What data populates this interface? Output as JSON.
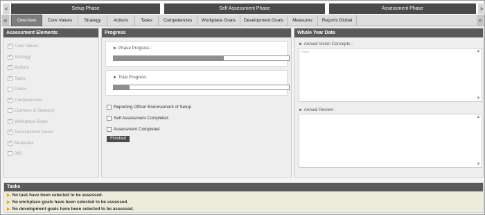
{
  "phases": [
    {
      "label": "Setup Phase"
    },
    {
      "label": "Self Assessment Phase"
    },
    {
      "label": "Assessment Phase"
    }
  ],
  "scroll": {
    "left": "«",
    "right": "»"
  },
  "tabs": [
    {
      "label": "Overview",
      "active": true
    },
    {
      "label": "Core Values"
    },
    {
      "label": "Strategy"
    },
    {
      "label": "Actions"
    },
    {
      "label": "Tasks"
    },
    {
      "label": "Competencies"
    },
    {
      "label": "Workplace Goals"
    },
    {
      "label": "Development Goals"
    },
    {
      "label": "Measures"
    },
    {
      "label": "Reports Global"
    }
  ],
  "assessment_elements": {
    "title": "Assessment Elements",
    "items": [
      {
        "label": "Core Values",
        "checked": true
      },
      {
        "label": "Strategy",
        "checked": true
      },
      {
        "label": "Actions",
        "checked": true
      },
      {
        "label": "Tasks",
        "checked": true
      },
      {
        "label": "Duties",
        "checked": false
      },
      {
        "label": "Competencies",
        "checked": true
      },
      {
        "label": "Licenses & Statutory",
        "checked": false
      },
      {
        "label": "Workplace Goals",
        "checked": true
      },
      {
        "label": "Development Goals",
        "checked": true
      },
      {
        "label": "Measures",
        "checked": true
      },
      {
        "label": "360",
        "checked": false
      }
    ]
  },
  "progress": {
    "title": "Progress",
    "phase_label": "► Phase Progress :",
    "phase_value": 0.63,
    "total_label": "► Total Progress :",
    "total_value": 0.09,
    "checks": [
      {
        "label": "Reporting Officer Endorsement of Setup"
      },
      {
        "label": "Self Assessment Completed"
      },
      {
        "label": "Assessment Completed"
      }
    ],
    "finished_label": "Finished"
  },
  "whole_year": {
    "title": "Whole Year Data",
    "vision_label": "► Annual Vision Concepts :",
    "vision_placeholder": "Save",
    "review_label": "► Annual Review :"
  },
  "tasks": {
    "title": "Tasks",
    "messages": [
      "No task have been selected to be assessed.",
      "No workplace goals have been selected to be assessed.",
      "No development goals have been selected to be assessed."
    ]
  }
}
